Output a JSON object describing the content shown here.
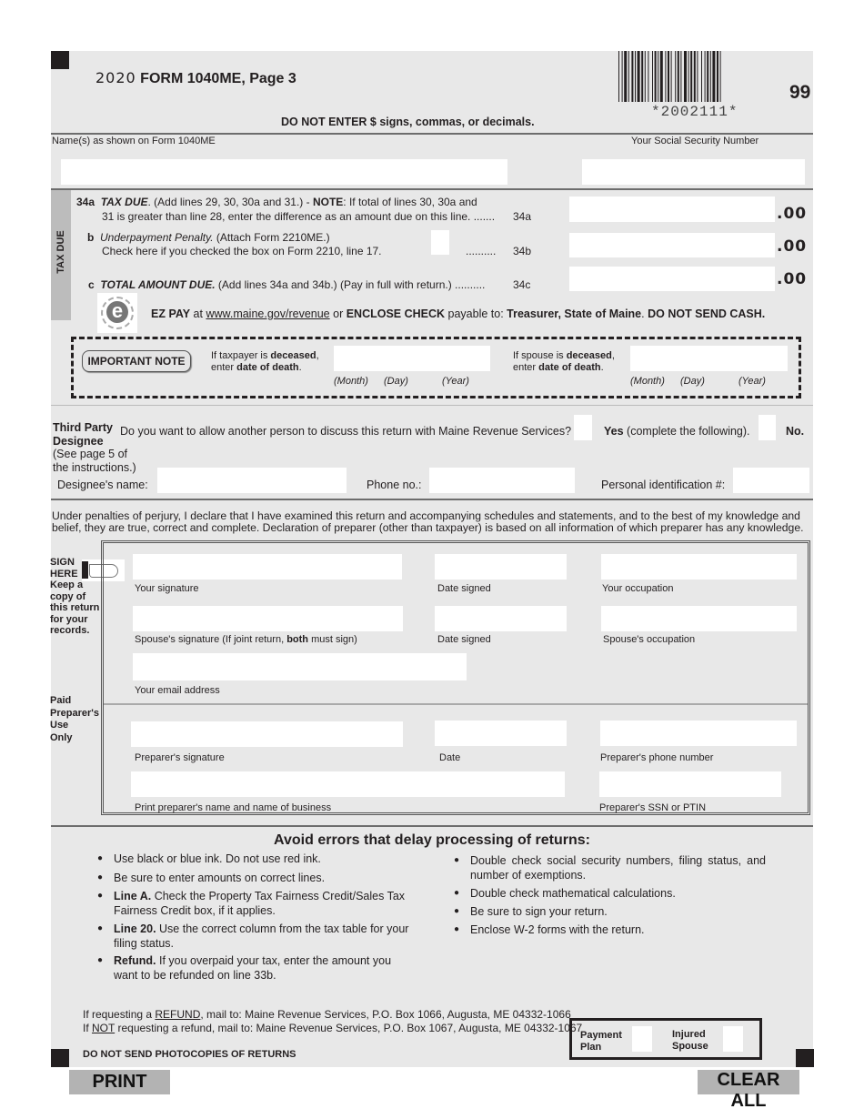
{
  "header": {
    "title_year": "2020",
    "title_rest": "FORM 1040ME, Page 3",
    "instruction": "DO NOT ENTER $ signs, commas, or decimals.",
    "barcode_text": "*2002111*",
    "form_code": "99"
  },
  "identity": {
    "name_label": "Name(s) as shown on Form 1040ME",
    "ssn_label": "Your Social Security Number",
    "name_value": "",
    "ssn_value": ""
  },
  "tax_due": {
    "side_label": "TAX DUE",
    "line34a": {
      "num": "34a",
      "title": "TAX DUE",
      "text1": ". (Add lines 29, 30, 30a and 31.) - ",
      "note": "NOTE",
      "text2": ": If total of lines 30, 30a and",
      "text3": "31 is greater than line 28, enter the difference as an amount due on this line. .......",
      "ref": "34a",
      "value": "",
      "cents": ".00"
    },
    "line34b": {
      "num": "b",
      "title": "Underpayment Penalty.",
      "text1": " (Attach Form 2210ME.)",
      "text2": "Check here if you checked the box on Form 2210, line 17.",
      "dots": "..........",
      "ref": "34b",
      "checked": false,
      "value": "",
      "cents": ".00"
    },
    "line34c": {
      "num": "c",
      "title": "TOTAL AMOUNT DUE.",
      "text1": " (Add lines 34a and 34b.) (Pay in full with return.) ..........",
      "ref": "34c",
      "value": "",
      "cents": ".00"
    },
    "ezpay": {
      "logo_letter": "e",
      "logo_ring": "EZPAY",
      "lead": "EZ PAY",
      "at": " at ",
      "link": "www.maine.gov/revenue",
      "or": " or ",
      "enclose": "ENCLOSE CHECK",
      "payable": " payable to: ",
      "payee": "Treasurer, State of Maine",
      "period": ". ",
      "warning": "DO NOT SEND CASH."
    }
  },
  "important_note": {
    "badge": "IMPORTANT NOTE",
    "taxpayer_l1a": "If taxpayer is ",
    "taxpayer_l1b": "deceased",
    "taxpayer_l1c": ",",
    "taxpayer_l2a": "enter ",
    "taxpayer_l2b": "date of death",
    "taxpayer_l2c": ".",
    "spouse_l1a": "If spouse is ",
    "spouse_l1b": "deceased",
    "spouse_l1c": ",",
    "spouse_l2a": "enter ",
    "spouse_l2b": "date of death",
    "spouse_l2c": ".",
    "month": "(Month)",
    "day": "(Day)",
    "year": "(Year)",
    "taxpayer_date": "",
    "spouse_date": ""
  },
  "third_party": {
    "heading1": "Third Party",
    "heading2": "Designee",
    "note1": "(See page 5 of",
    "note2": "the instructions.)",
    "question": "Do you want to allow another person to discuss this return with Maine Revenue Services?",
    "yes_bold": "Yes",
    "yes_rest": " (complete the following).",
    "no": "No.",
    "yes_checked": false,
    "no_checked": false,
    "designee_name_label": "Designee's name:",
    "phone_label": "Phone no.:",
    "pin_label": "Personal identification #:",
    "designee_name": "",
    "phone": "",
    "pin": ""
  },
  "declaration": {
    "line1": "Under penalties of perjury, I declare that I have examined this return and accompanying schedules and statements, and to the best of my knowledge and",
    "line2": "belief, they are true, correct and complete. Declaration of preparer (other than taxpayer) is based on all information of which preparer has any knowledge."
  },
  "sign": {
    "side": [
      "SIGN",
      "HERE",
      "Keep a",
      "copy of",
      "this return",
      "for your",
      "records."
    ],
    "your_signature": "Your signature",
    "date_signed": "Date signed",
    "your_occupation": "Your occupation",
    "spouse_signature_a": "Spouse's signature (If joint return, ",
    "spouse_signature_b": "both",
    "spouse_signature_c": " must sign)",
    "spouse_date_signed": "Date signed",
    "spouse_occupation": "Spouse's occupation",
    "email": "Your email address"
  },
  "preparer": {
    "side": [
      "Paid",
      "Preparer's",
      "Use",
      "Only"
    ],
    "signature": "Preparer's signature",
    "date": "Date",
    "phone": "Preparer's phone number",
    "name_business": "Print preparer's name and name of business",
    "ssn_ptin": "Preparer's SSN or PTIN"
  },
  "avoid_errors": {
    "title": "Avoid errors that delay processing of returns:",
    "left": [
      {
        "bold": "",
        "text": "Use black or blue ink. Do not use red ink."
      },
      {
        "bold": "",
        "text": "Be sure to enter amounts on correct lines."
      },
      {
        "bold": "Line A.",
        "text": " Check the Property Tax Fairness Credit/Sales Tax Fairness Credit box, if it applies."
      },
      {
        "bold": "Line 20.",
        "text": " Use the correct column from the tax table for your filing status."
      },
      {
        "bold": "Refund.",
        "text": " If you overpaid your tax, enter the amount you want to be refunded on line 33b."
      }
    ],
    "right": [
      {
        "text": "Double check social security numbers, filing status, and number of exemptions."
      },
      {
        "text": "Double check mathematical calculations."
      },
      {
        "text": "Be sure to sign your return."
      },
      {
        "text": "Enclose W-2 forms with the return."
      }
    ]
  },
  "mailing": {
    "refund_a": "If requesting a ",
    "refund_u": "REFUND",
    "refund_b": ", mail to: Maine Revenue Services, P.O. Box 1066, Augusta, ME  04332-1066",
    "norefund_a": "If ",
    "norefund_u": "NOT",
    "norefund_b": " requesting a refund, mail to: Maine Revenue Services, P.O. Box 1067, Augusta, ME  04332-1067",
    "no_photocopies": "DO NOT SEND PHOTOCOPIES OF RETURNS"
  },
  "flags": {
    "payment_plan_1": "Payment",
    "payment_plan_2": "Plan",
    "injured_spouse_1": "Injured",
    "injured_spouse_2": "Spouse",
    "payment_plan_checked": false,
    "injured_spouse_checked": false
  },
  "buttons": {
    "print": "PRINT",
    "clear_all": "CLEAR ALL"
  }
}
